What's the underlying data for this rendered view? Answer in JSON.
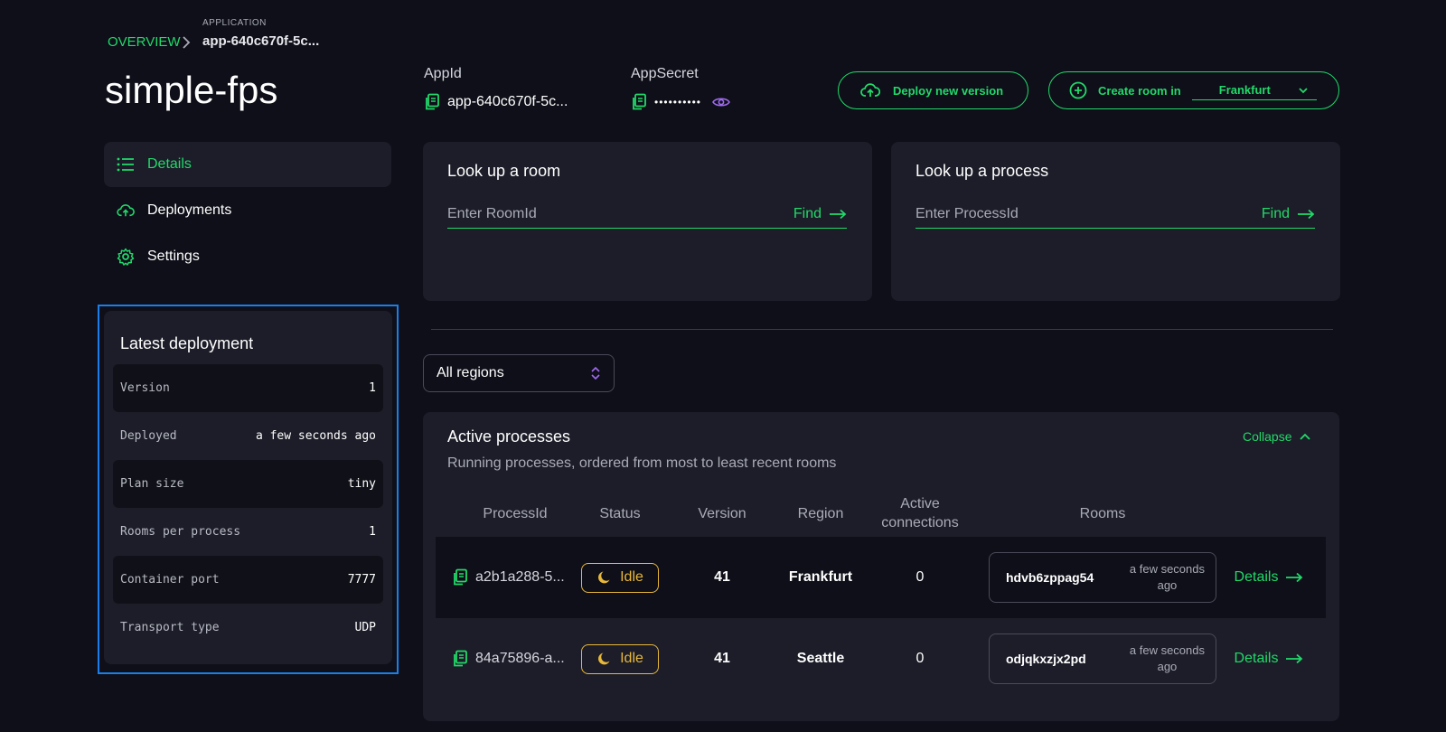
{
  "breadcrumb": {
    "overview": "OVERVIEW",
    "app_label": "APPLICATION",
    "app": "app-640c670f-5c..."
  },
  "page_title": "simple-fps",
  "app_meta": {
    "appid_label": "AppId",
    "appid_value": "app-640c670f-5c...",
    "secret_label": "AppSecret",
    "secret_value": "••••••••••"
  },
  "actions": {
    "deploy_label": "Deploy new version",
    "create_room_label": "Create room in",
    "create_room_region": "Frankfurt"
  },
  "sidebar": {
    "items": [
      {
        "label": "Details",
        "icon": "list-icon",
        "active": true
      },
      {
        "label": "Deployments",
        "icon": "cloud-upload-icon",
        "active": false
      },
      {
        "label": "Settings",
        "icon": "gear-icon",
        "active": false
      }
    ]
  },
  "latest_deployment": {
    "title": "Latest deployment",
    "rows": [
      {
        "label": "Version",
        "value": "1"
      },
      {
        "label": "Deployed",
        "value": "a few seconds ago"
      },
      {
        "label": "Plan size",
        "value": "tiny"
      },
      {
        "label": "Rooms per process",
        "value": "1"
      },
      {
        "label": "Container port",
        "value": "7777"
      },
      {
        "label": "Transport type",
        "value": "UDP"
      }
    ]
  },
  "lookup_room": {
    "title": "Look up a room",
    "placeholder": "Enter RoomId",
    "find": "Find"
  },
  "lookup_process": {
    "title": "Look up a process",
    "placeholder": "Enter ProcessId",
    "find": "Find"
  },
  "regions_select": "All regions",
  "processes": {
    "title": "Active processes",
    "subtitle": "Running processes, ordered from most to least recent rooms",
    "collapse": "Collapse",
    "columns": {
      "process_id": "ProcessId",
      "status": "Status",
      "version": "Version",
      "region": "Region",
      "active_connections_1": "Active",
      "active_connections_2": "connections",
      "rooms": "Rooms"
    },
    "rows": [
      {
        "process_id": "a2b1a288-5...",
        "status": "Idle",
        "version": "41",
        "region": "Frankfurt",
        "connections": "0",
        "room_id": "hdvb6zppag54",
        "room_time_1": "a few seconds",
        "room_time_2": "ago",
        "details": "Details"
      },
      {
        "process_id": "84a75896-a...",
        "status": "Idle",
        "version": "41",
        "region": "Seattle",
        "connections": "0",
        "room_id": "odjqkxzjx2pd",
        "room_time_1": "a few seconds",
        "room_time_2": "ago",
        "details": "Details"
      }
    ]
  },
  "colors": {
    "accent": "#22d96a",
    "idle": "#e8b83a",
    "selection": "#1a7fea",
    "eye": "#a06bf0",
    "card": "#1c1d28",
    "background": "#0e0f18"
  }
}
